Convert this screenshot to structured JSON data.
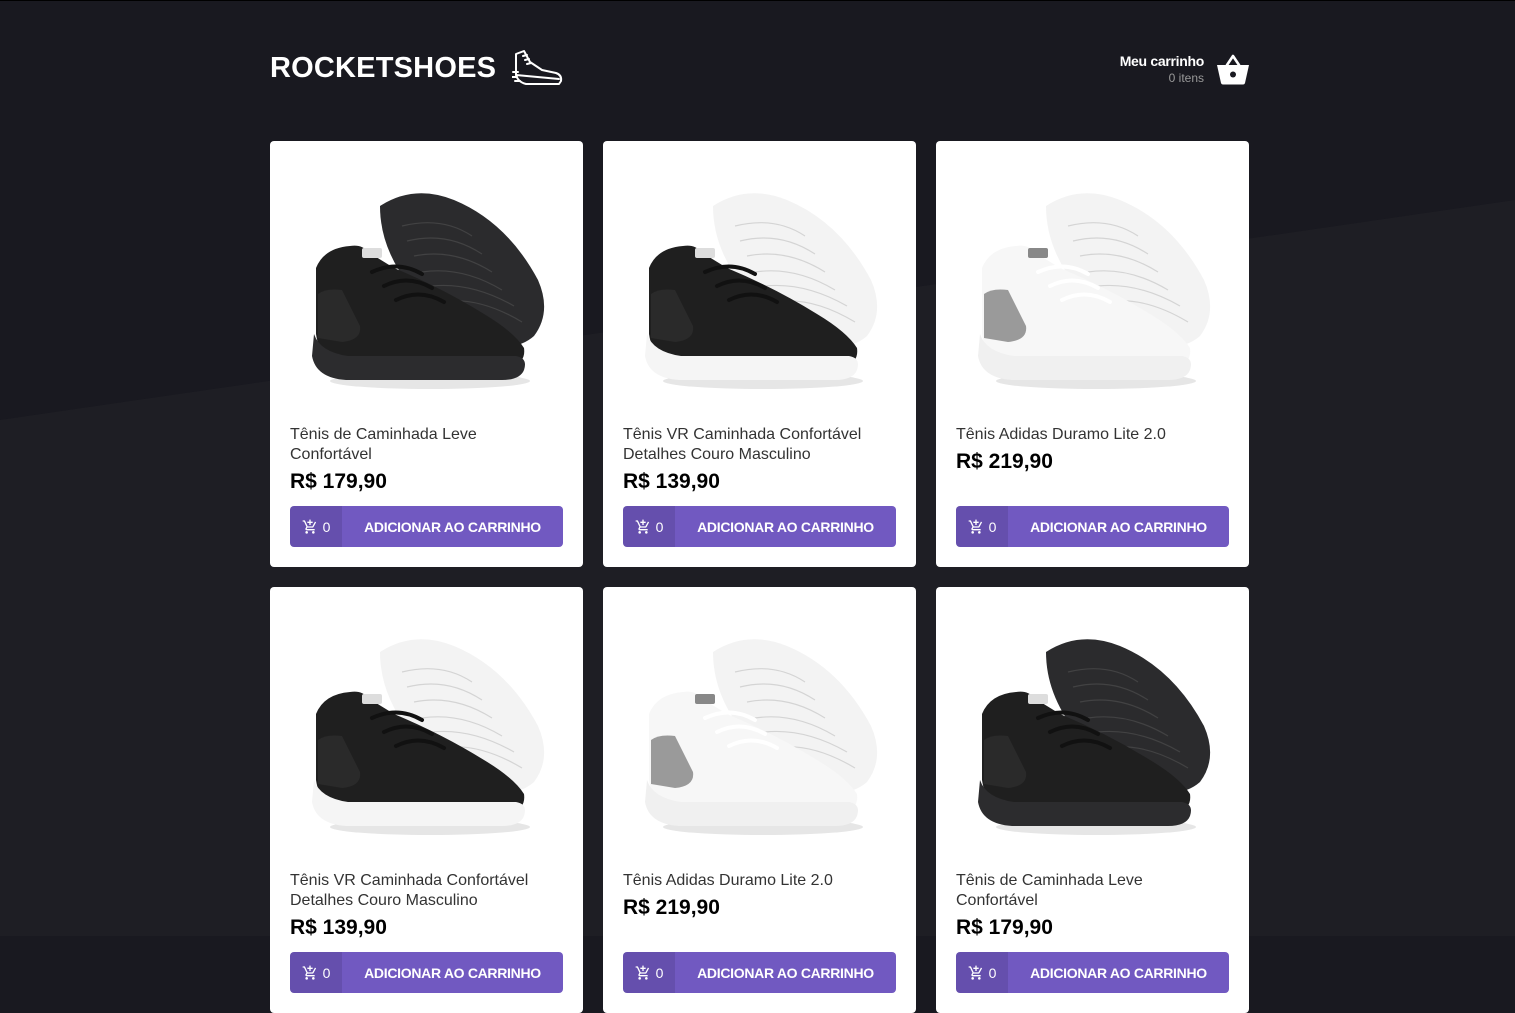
{
  "header": {
    "logo_text": "ROCKETSHOES",
    "cart_title": "Meu carrinho",
    "cart_count": "0 itens"
  },
  "colors": {
    "background": "#191920",
    "accent": "#7159c1",
    "card": "#ffffff"
  },
  "products": [
    {
      "title": "Tênis de Caminhada Leve Confortável",
      "price": "R$ 179,90",
      "amount": "0",
      "button_label": "ADICIONAR AO CARRINHO",
      "variant": "black-black"
    },
    {
      "title": "Tênis VR Caminhada Confortável Detalhes Couro Masculino",
      "price": "R$ 139,90",
      "amount": "0",
      "button_label": "ADICIONAR AO CARRINHO",
      "variant": "black-white"
    },
    {
      "title": "Tênis Adidas Duramo Lite 2.0",
      "price": "R$ 219,90",
      "amount": "0",
      "button_label": "ADICIONAR AO CARRINHO",
      "variant": "white-grey"
    },
    {
      "title": "Tênis VR Caminhada Confortável Detalhes Couro Masculino",
      "price": "R$ 139,90",
      "amount": "0",
      "button_label": "ADICIONAR AO CARRINHO",
      "variant": "black-white"
    },
    {
      "title": "Tênis Adidas Duramo Lite 2.0",
      "price": "R$ 219,90",
      "amount": "0",
      "button_label": "ADICIONAR AO CARRINHO",
      "variant": "white-grey"
    },
    {
      "title": "Tênis de Caminhada Leve Confortável",
      "price": "R$ 179,90",
      "amount": "0",
      "button_label": "ADICIONAR AO CARRINHO",
      "variant": "black-black"
    }
  ]
}
